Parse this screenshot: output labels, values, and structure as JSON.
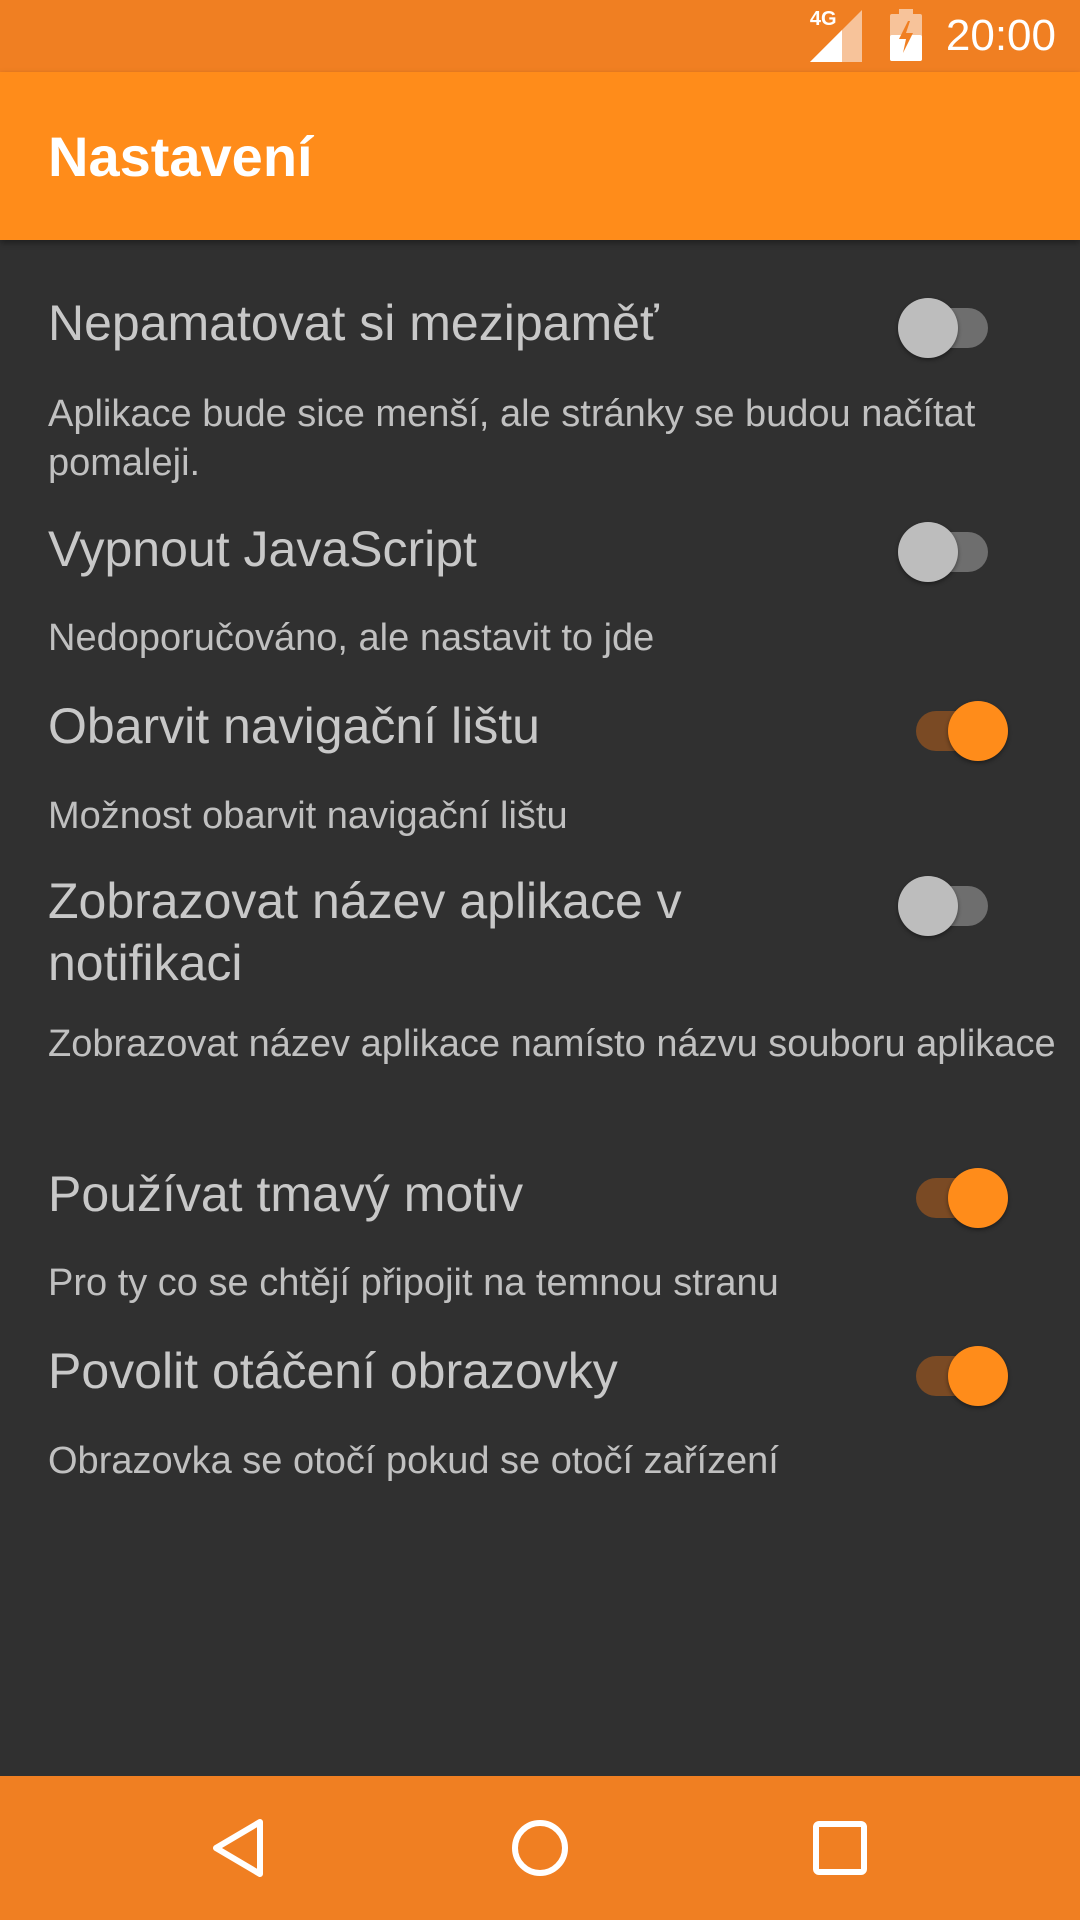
{
  "status_bar": {
    "network": "4G",
    "time": "20:00",
    "color": "#F07F22"
  },
  "app_bar": {
    "title": "Nastavení",
    "color": "#FF8C1A"
  },
  "preferences": [
    {
      "title": "Nepamatovat si mezipaměť",
      "summary": "Aplikace bude sice menší, ale stránky se budou načítat pomaleji.",
      "enabled": false
    },
    {
      "title": "Vypnout JavaScript",
      "summary": "Nedoporučováno, ale nastavit to jde",
      "enabled": false
    },
    {
      "title": "Obarvit navigační lištu",
      "summary": "Možnost obarvit navigační lištu",
      "enabled": true
    },
    {
      "title": "Zobrazovat název aplikace v notifikaci",
      "summary": "Zobrazovat název aplikace namísto názvu souboru aplikace",
      "enabled": false
    },
    {
      "title": "Používat tmavý motiv",
      "summary": "Pro ty co se chtějí připojit na temnou stranu",
      "enabled": true
    },
    {
      "title": "Povolit otáčení obrazovky",
      "summary": "Obrazovka se otočí pokud se otočí zařízení",
      "enabled": true
    }
  ],
  "nav_bar": {
    "back_icon": "back-icon",
    "home_icon": "home-icon",
    "recents_icon": "recents-icon",
    "color": "#F07F22"
  }
}
